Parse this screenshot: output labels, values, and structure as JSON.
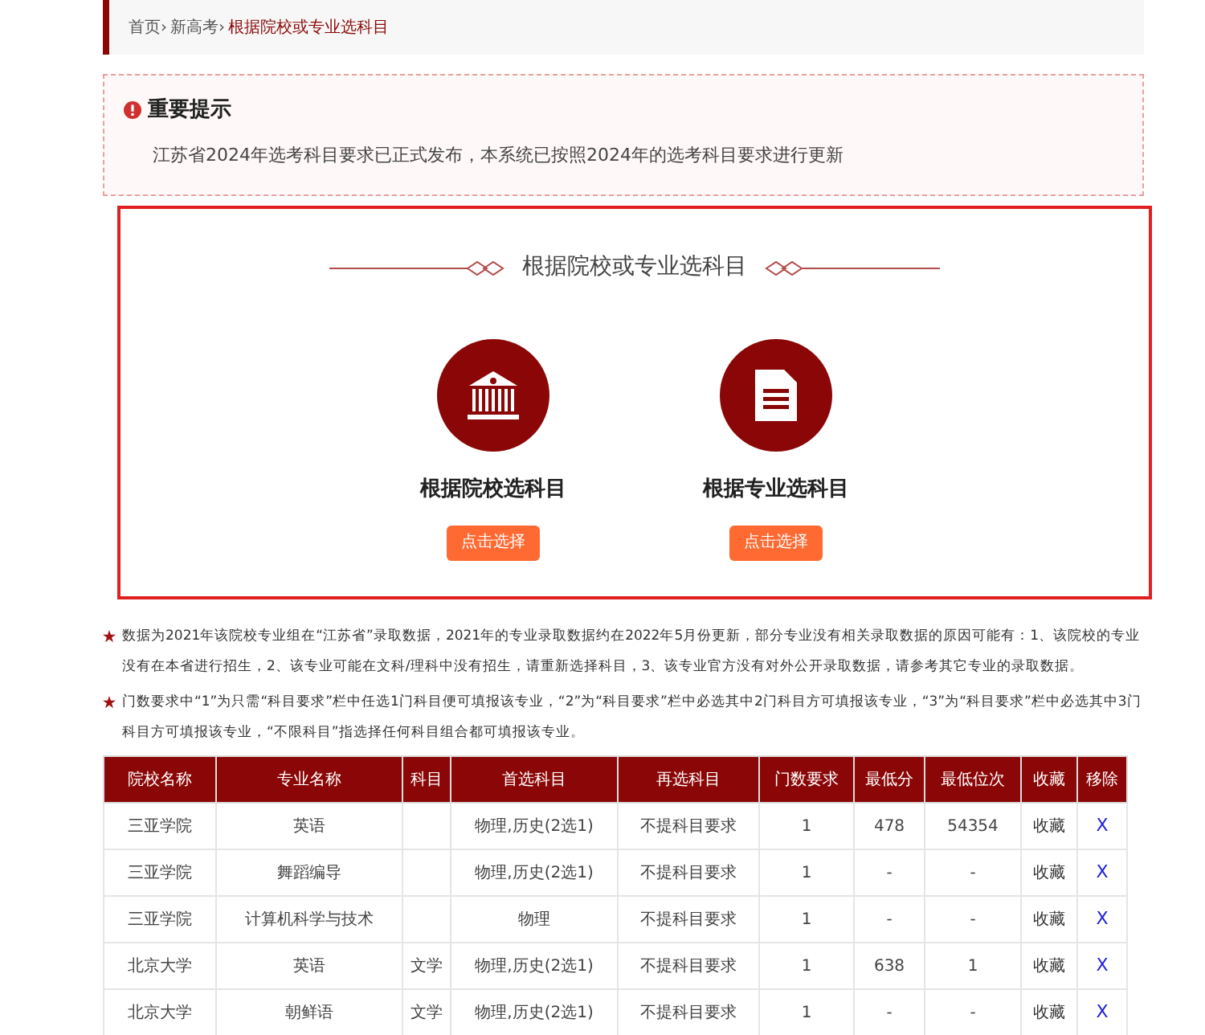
{
  "breadcrumb": {
    "separator": "›",
    "items": [
      {
        "label": "首页",
        "current": false
      },
      {
        "label": "新高考",
        "current": false
      },
      {
        "label": "根据院校或专业选科目",
        "current": true
      }
    ]
  },
  "notice": {
    "title": "重要提示",
    "text": "江苏省2024年选考科目要求已正式发布，本系统已按照2024年的选考科目要求进行更新"
  },
  "chooser": {
    "title": "根据院校或专业选科目",
    "options": [
      {
        "kind": "school",
        "label": "根据院校选科目",
        "button": "点击选择"
      },
      {
        "kind": "major",
        "label": "根据专业选科目",
        "button": "点击选择"
      }
    ]
  },
  "notes": [
    "数据为2021年该院校专业组在“江苏省”录取数据，2021年的专业录取数据约在2022年5月份更新，部分专业没有相关录取数据的原因可能有：1、该院校的专业没有在本省进行招生，2、该专业可能在文科/理科中没有招生，请重新选择科目，3、该专业官方没有对外公开录取数据，请参考其它专业的录取数据。",
    "门数要求中“1”为只需“科目要求”栏中任选1门科目便可填报该专业，“2”为“科目要求”栏中必选其中2门科目方可填报该专业，“3”为“科目要求”栏中必选其中3门科目方可填报该专业，“不限科目”指选择任何科目组合都可填报该专业。"
  ],
  "table": {
    "columns": [
      "院校名称",
      "专业名称",
      "科目",
      "首选科目",
      "再选科目",
      "门数要求",
      "最低分",
      "最低位次",
      "收藏",
      "移除"
    ],
    "rows": [
      {
        "school": "三亚学院",
        "major": "英语",
        "subject": "",
        "first": "物理,历史(2选1)",
        "second": "不提科目要求",
        "count": "1",
        "min_score": "478",
        "min_rank": "54354",
        "favorite": "收藏",
        "remove": "X"
      },
      {
        "school": "三亚学院",
        "major": "舞蹈编导",
        "subject": "",
        "first": "物理,历史(2选1)",
        "second": "不提科目要求",
        "count": "1",
        "min_score": "-",
        "min_rank": "-",
        "favorite": "收藏",
        "remove": "X"
      },
      {
        "school": "三亚学院",
        "major": "计算机科学与技术",
        "subject": "",
        "first": "物理",
        "second": "不提科目要求",
        "count": "1",
        "min_score": "-",
        "min_rank": "-",
        "favorite": "收藏",
        "remove": "X"
      },
      {
        "school": "北京大学",
        "major": "英语",
        "subject": "文学",
        "first": "物理,历史(2选1)",
        "second": "不提科目要求",
        "count": "1",
        "min_score": "638",
        "min_rank": "1",
        "favorite": "收藏",
        "remove": "X"
      },
      {
        "school": "北京大学",
        "major": "朝鲜语",
        "subject": "文学",
        "first": "物理,历史(2选1)",
        "second": "不提科目要求",
        "count": "1",
        "min_score": "-",
        "min_rank": "-",
        "favorite": "收藏",
        "remove": "X"
      }
    ]
  }
}
